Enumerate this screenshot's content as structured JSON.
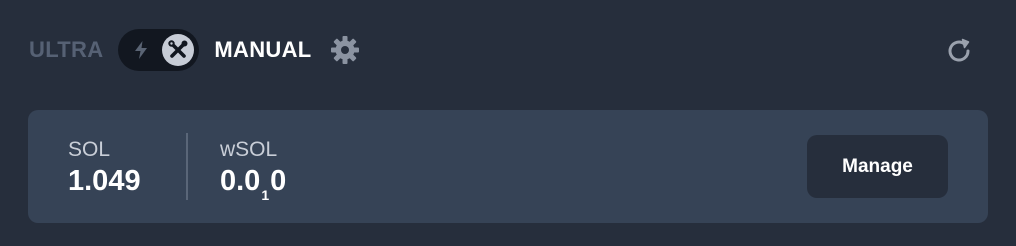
{
  "mode": {
    "ultra_label": "ULTRA",
    "manual_label": "MANUAL",
    "active": "MANUAL"
  },
  "icons": {
    "toggle_left": "lightning-bolt-icon",
    "toggle_knob": "wrench-screwdriver-icon",
    "settings": "gear-icon",
    "refresh": "refresh-icon"
  },
  "balances": {
    "sol": {
      "label": "SOL",
      "value": "1.049"
    },
    "wsol": {
      "label": "wSOL",
      "value_prefix": "0.0",
      "value_sub": "1",
      "value_suffix": "0"
    }
  },
  "actions": {
    "manage_label": "Manage"
  },
  "colors": {
    "background": "#262e3c",
    "card": "#364356",
    "toggle_track": "#121720",
    "inactive_text": "#566174",
    "active_text": "#ffffff"
  }
}
